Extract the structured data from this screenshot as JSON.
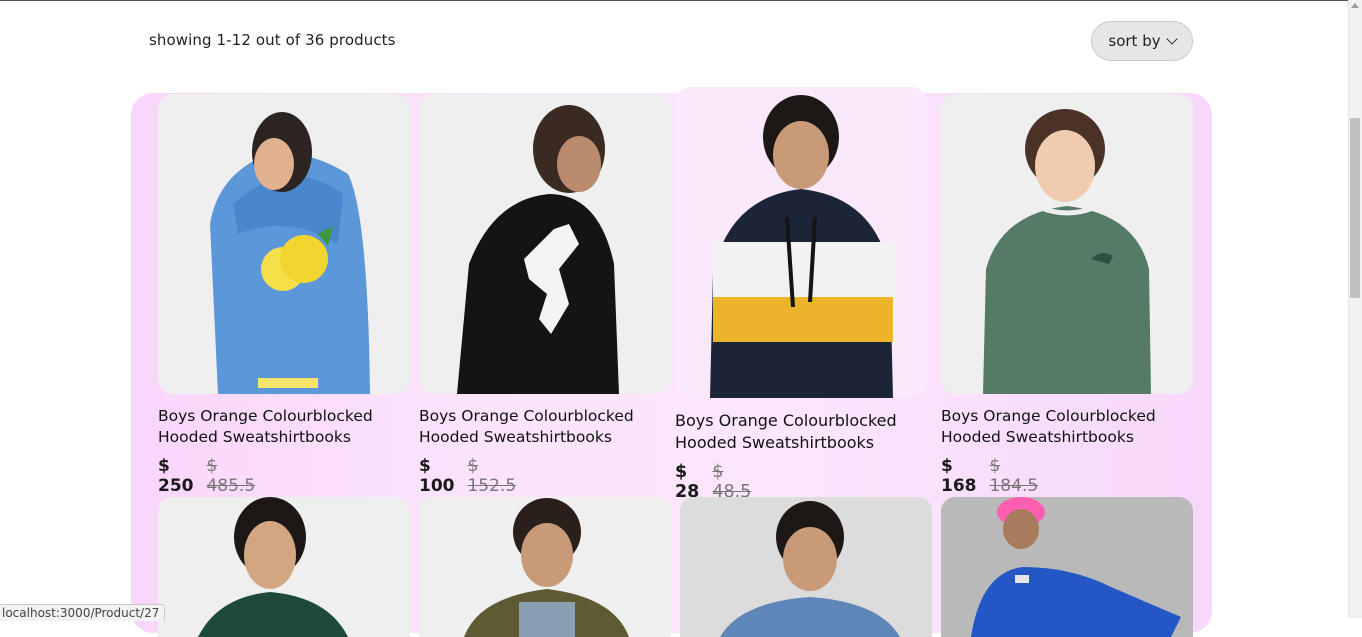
{
  "listing": {
    "showing_text": "showing 1-12 out of 36 products",
    "sort_label": "sort by"
  },
  "products": [
    {
      "name": "Boys Orange Colourblocked Hooded Sweatshirtbooks",
      "price": "$ 250",
      "old_price": "$ 485.5",
      "image": "boy in blue lemon hoodie, back view"
    },
    {
      "name": "Boys Orange Colourblocked Hooded Sweatshirtbooks",
      "price": "$ 100",
      "old_price": "$ 152.5",
      "image": "boy in black hoodie with white footballer print"
    },
    {
      "name": "Boys Orange Colourblocked Hooded Sweatshirtbooks",
      "price": "$ 28",
      "old_price": "$ 48.5",
      "image": "boy in navy white yellow colourblocked hoodie"
    },
    {
      "name": "Boys Orange Colourblocked Hooded Sweatshirtbooks",
      "price": "$ 168",
      "old_price": "$ 184.5",
      "image": "boy in green sweatshirt"
    },
    {
      "name": "",
      "price": "",
      "old_price": "",
      "image": "boy in dark green jacket"
    },
    {
      "name": "",
      "price": "",
      "old_price": "",
      "image": "boy in olive padded jacket"
    },
    {
      "name": "",
      "price": "",
      "old_price": "",
      "image": "boy in denim jacket"
    },
    {
      "name": "",
      "price": "",
      "old_price": "",
      "image": "boy in blue sweatshirt with pink beanie"
    }
  ],
  "status_bar": {
    "url": "localhost:3000/Product/27"
  },
  "colors": {
    "panel": "#fbe3fc",
    "sort_bg": "#e6e6e6"
  }
}
